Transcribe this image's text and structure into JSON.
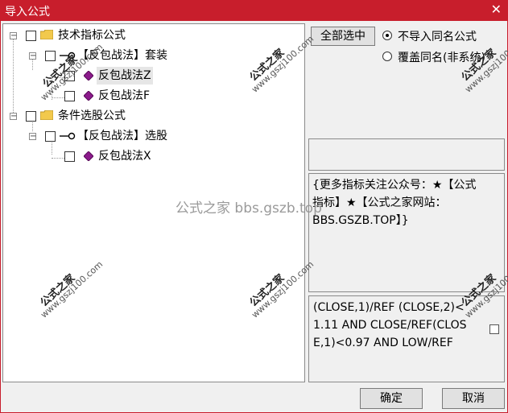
{
  "window": {
    "title": "导入公式",
    "close_glyph": "✕"
  },
  "tree": {
    "groups": [
      {
        "label": "技术指标公式",
        "children": [
          {
            "label": "【反包战法】套装",
            "children": [
              {
                "label": "反包战法Z"
              },
              {
                "label": "反包战法F"
              }
            ]
          }
        ]
      },
      {
        "label": "条件选股公式",
        "children": [
          {
            "label": "【反包战法】选股",
            "children": [
              {
                "label": "反包战法X"
              }
            ]
          }
        ]
      }
    ]
  },
  "options": {
    "select_all_label": "全部选中",
    "radio_skip_label": "不导入同名公式",
    "radio_overwrite_label": "覆盖同名(非系统)",
    "selected": "skip"
  },
  "description": {
    "text": "{更多指标关注公众号：★【公式指标】★【公式之家网站：BBS.GSZB.TOP】}"
  },
  "formula_preview": {
    "text": "(CLOSE,1)/REF (CLOSE,2)<1.11 AND CLOSE/REF(CLOSE,1)<0.97 AND LOW/REF"
  },
  "buttons": {
    "ok_label": "确定",
    "cancel_label": "取消"
  },
  "watermarks": {
    "center": "公式之家 bbs.gszb.top",
    "stamp_main": "公式之家",
    "stamp_url": "www.gszj100.com"
  },
  "colors": {
    "title_bar": "#c81e2c",
    "gem": "#8b1a8b",
    "folder": "#f2c94c"
  }
}
